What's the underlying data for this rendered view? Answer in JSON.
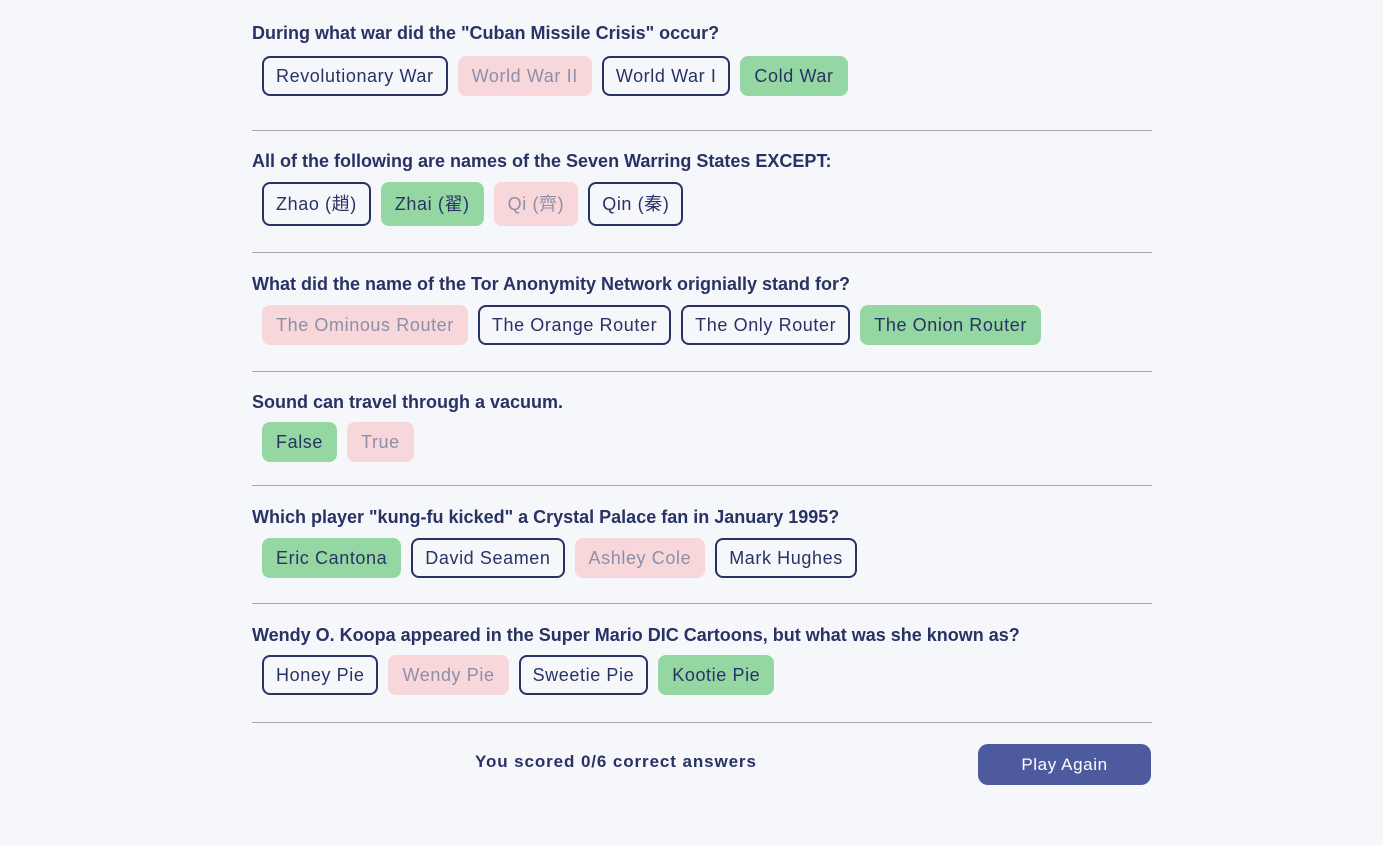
{
  "questions": [
    {
      "text": "During what war did the \"Cuban Missile Crisis\" occur?",
      "answers": [
        {
          "label": "Revolutionary War",
          "state": "neutral"
        },
        {
          "label": "World War II",
          "state": "wrong"
        },
        {
          "label": "World War I",
          "state": "neutral"
        },
        {
          "label": "Cold War",
          "state": "correct"
        }
      ]
    },
    {
      "text": "All of the following are names of the Seven Warring States EXCEPT:",
      "answers": [
        {
          "label": "Zhao (趙)",
          "state": "neutral"
        },
        {
          "label": "Zhai (翟)",
          "state": "correct"
        },
        {
          "label": "Qi (齊)",
          "state": "wrong"
        },
        {
          "label": "Qin (秦)",
          "state": "neutral"
        }
      ]
    },
    {
      "text": "What did the name of the Tor Anonymity Network orignially stand for?",
      "answers": [
        {
          "label": "The Ominous Router",
          "state": "wrong"
        },
        {
          "label": "The Orange Router",
          "state": "neutral"
        },
        {
          "label": "The Only Router",
          "state": "neutral"
        },
        {
          "label": "The Onion Router",
          "state": "correct"
        }
      ]
    },
    {
      "text": "Sound can travel through a vacuum.",
      "answers": [
        {
          "label": "False",
          "state": "correct"
        },
        {
          "label": "True",
          "state": "wrong"
        }
      ]
    },
    {
      "text": "Which player \"kung-fu kicked\" a Crystal Palace fan in January 1995?",
      "answers": [
        {
          "label": "Eric Cantona",
          "state": "correct"
        },
        {
          "label": "David Seamen",
          "state": "neutral"
        },
        {
          "label": "Ashley Cole",
          "state": "wrong"
        },
        {
          "label": "Mark Hughes",
          "state": "neutral"
        }
      ]
    },
    {
      "text": "Wendy O. Koopa appeared in the Super Mario DIC Cartoons, but what was she known as?",
      "answers": [
        {
          "label": "Honey Pie",
          "state": "neutral"
        },
        {
          "label": "Wendy Pie",
          "state": "wrong"
        },
        {
          "label": "Sweetie Pie",
          "state": "neutral"
        },
        {
          "label": "Kootie Pie",
          "state": "correct"
        }
      ]
    }
  ],
  "footer": {
    "score_text": "You scored 0/6 correct answers",
    "play_again_label": "Play Again"
  },
  "colors": {
    "background": "#f5f7fb",
    "text": "#293264",
    "correct": "#94d7a2",
    "wrong": "#f8d7da",
    "button": "#4d5b9e"
  }
}
